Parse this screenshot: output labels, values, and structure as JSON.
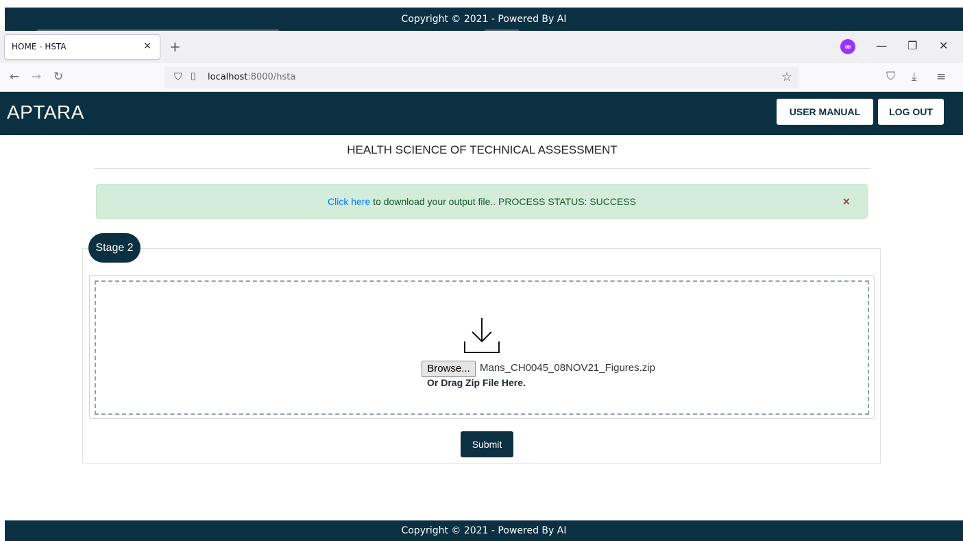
{
  "overlay_footer": {
    "text": "Copyright © 2021 - Powered By AI"
  },
  "browser": {
    "tab": {
      "title": "HOME - HSTA",
      "close": "×"
    },
    "new_tab": "+",
    "url": {
      "host": "localhost",
      "rest": ":8000/hsta"
    },
    "icons": [
      "back-icon",
      "forward-icon",
      "reload-icon",
      "shield-icon",
      "page-icon",
      "star-icon",
      "pocket-icon",
      "download-icon",
      "menu-icon"
    ]
  },
  "header": {
    "brand": "APTARA",
    "user_manual": "USER MANUAL",
    "logout": "LOG OUT"
  },
  "page": {
    "title": "HEALTH SCIENCE OF TECHNICAL ASSESSMENT"
  },
  "alert": {
    "link": "Click here",
    "message": " to download your output file.. PROCESS STATUS: SUCCESS",
    "close": "×"
  },
  "stage": {
    "label": "Stage 2",
    "browse": "Browse...",
    "file_name": "Mans_CH0045_08NOV21_Figures.zip",
    "drag_text": "Or Drag Zip File Here.",
    "submit": "Submit"
  },
  "footer": {
    "text": "Copyright © 2021 - Powered By AI"
  },
  "colors": {
    "brand_dark": "#0b3042",
    "alert_bg": "#d4edda",
    "link": "#007bff"
  }
}
